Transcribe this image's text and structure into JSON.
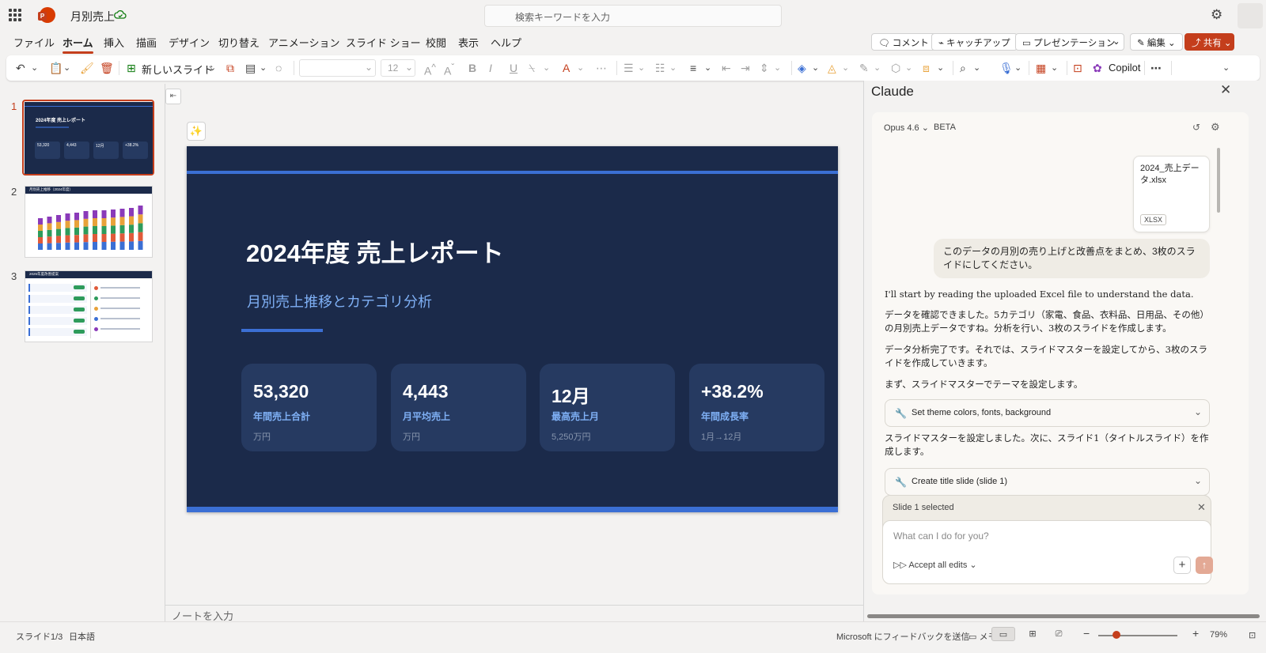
{
  "app": {
    "doc_title": "月別売上",
    "search_placeholder": "検索キーワードを入力"
  },
  "menu_tabs": [
    "ファイル",
    "ホーム",
    "挿入",
    "描画",
    "デザイン",
    "切り替え",
    "アニメーション",
    "スライド ショー",
    "校閲",
    "表示",
    "ヘルプ"
  ],
  "active_tab": "ホーム",
  "top_buttons": {
    "comment": "コメント",
    "catchup": "キャッチアップ",
    "present": "プレゼンテーション",
    "edit": "編集",
    "share": "共有"
  },
  "ribbon": {
    "new_slide": "新しいスライド",
    "font_size": "12",
    "copilot": "Copilot"
  },
  "thumbnails": {
    "numbers": [
      "1",
      "2",
      "3"
    ],
    "thumb1_title": "2024年度 売上レポート",
    "thumb1_kpis": [
      "53,320",
      "4,443",
      "12月",
      "+38.2%"
    ],
    "thumb2_title": "月別売上推移（2024年度）",
    "thumb3_title": "2025年度改善提案"
  },
  "slide": {
    "title": "2024年度 売上レポート",
    "subtitle": "月別売上推移とカテゴリ分析",
    "kpis": [
      {
        "value": "53,320",
        "label": "年間売上合計",
        "unit": "万円"
      },
      {
        "value": "4,443",
        "label": "月平均売上",
        "unit": "万円"
      },
      {
        "value": "12月",
        "label": "最高売上月",
        "unit": "5,250万円"
      },
      {
        "value": "+38.2%",
        "label": "年間成長率",
        "unit": "1月→12月"
      }
    ],
    "colors": {
      "background": "#1b2a4a",
      "accent": "#3b6fd4",
      "card": "#263a61",
      "subtitle": "#7fb0f5"
    }
  },
  "notes_placeholder": "ノートを入力",
  "claude": {
    "title": "Claude",
    "model": "Opus 4.6",
    "beta": "BETA",
    "file_name": "2024_売上データ.xlsx",
    "file_badge": "XLSX",
    "user_message": "このデータの月別の売り上げと改善点をまとめ、3枚のスライドにしてください。",
    "messages": [
      "I'll start by reading the uploaded Excel file to understand the data.",
      "データを確認できました。5カテゴリ（家電、食品、衣料品、日用品、その他）の月別売上データですね。分析を行い、3枚のスライドを作成します。",
      "データ分析完了です。それでは、スライドマスターを設定してから、3枚のスライドを作成していきます。",
      "まず、スライドマスターでテーマを設定します。",
      "スライドマスターを設定しました。次に、スライド1（タイトルスライド）を作成します。"
    ],
    "tool_calls": [
      "Set theme colors, fonts, background",
      "Create title slide (slide 1)"
    ],
    "selection_chip": "Slide 1 selected",
    "input_placeholder": "What can I do for you?",
    "accept_all": "Accept all edits"
  },
  "status": {
    "slide_pos": "スライド1/3",
    "language": "日本語",
    "feedback": "Microsoft にフィードバックを送信",
    "notes": "メモ",
    "zoom": "79%"
  }
}
